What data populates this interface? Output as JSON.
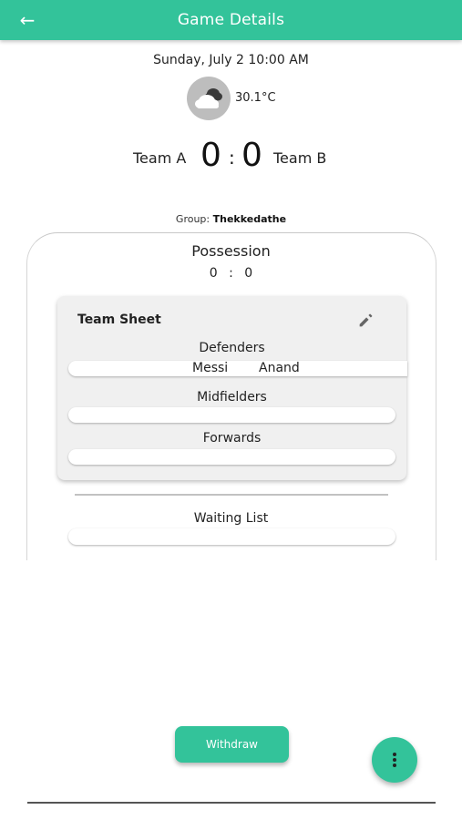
{
  "appbar": {
    "title": "Game Details",
    "back_icon": "arrow-left-icon"
  },
  "game": {
    "datetime": "Sunday, July 2 10:00 AM",
    "weather_icon": "cloud-icon",
    "temperature": "30.1°C",
    "team_a": "Team A",
    "team_b": "Team B",
    "score_a": "0",
    "score_b": "0",
    "score_separator": ":",
    "group_label": "Group:",
    "group_name": "Thekkedathe"
  },
  "possession": {
    "title": "Possession",
    "value": "0 : 0"
  },
  "team_sheet": {
    "title": "Team Sheet",
    "edit_icon": "pencil-icon",
    "defenders_label": "Defenders",
    "defenders": [
      "Messi",
      "Anand"
    ],
    "midfielders_label": "Midfielders",
    "forwards_label": "Forwards"
  },
  "waiting_list": {
    "label": "Waiting List"
  },
  "actions": {
    "withdraw_label": "Withdraw",
    "more_icon": "more-vertical-icon"
  },
  "colors": {
    "accent": "#33c39a",
    "card": "#f0f0f0",
    "weather_bg": "#bdbdbd"
  }
}
